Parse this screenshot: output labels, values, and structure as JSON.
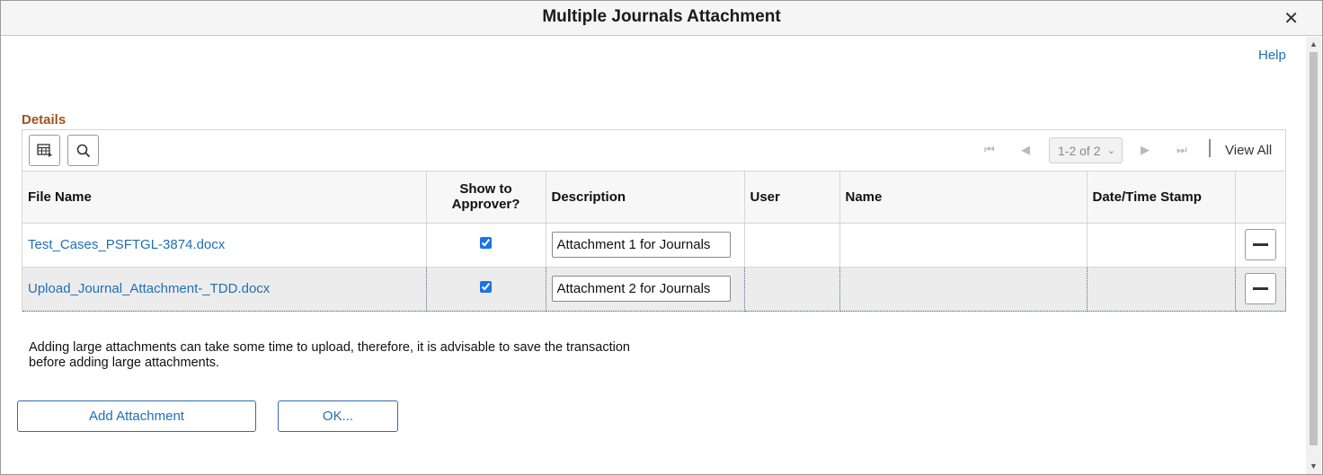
{
  "dialog": {
    "title": "Multiple Journals Attachment",
    "close_glyph": "✕"
  },
  "help_label": "Help",
  "section_title": "Details",
  "toolbar": {
    "personalize_icon": "grid-personalize-icon",
    "search_icon": "search-icon",
    "pager_value": "1-2 of 2",
    "view_all_label": "View All"
  },
  "table": {
    "headers": {
      "file_name": "File Name",
      "show_line1": "Show to",
      "show_line2": "Approver?",
      "description": "Description",
      "user": "User",
      "name": "Name",
      "datetime": "Date/Time Stamp"
    },
    "rows": [
      {
        "file_name": "Test_Cases_PSFTGL-3874.docx",
        "show_to_approver": true,
        "description": "Attachment 1 for Journals",
        "user": "",
        "name": "",
        "datetime": ""
      },
      {
        "file_name": "Upload_Journal_Attachment-_TDD.docx",
        "show_to_approver": true,
        "description": "Attachment 2 for Journals",
        "user": "",
        "name": "",
        "datetime": ""
      }
    ]
  },
  "note": "Adding large attachments can take some time to upload, therefore, it is advisable to save the transaction before adding large attachments.",
  "buttons": {
    "add_attachment": "Add Attachment",
    "ok": "OK..."
  },
  "colors": {
    "link": "#1f6fb5",
    "section_title": "#a0521d",
    "selected_row_bg": "#ececec"
  }
}
